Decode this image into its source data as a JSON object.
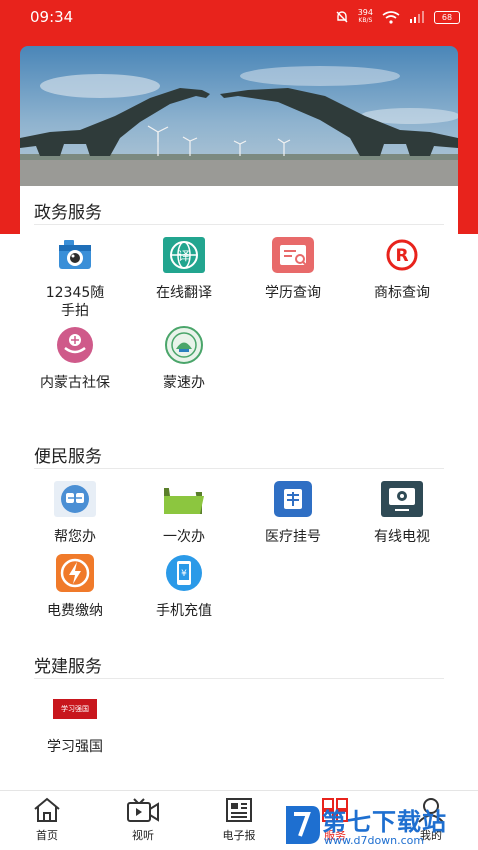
{
  "status_bar": {
    "time": "09:34",
    "speed": "394",
    "speed_unit": "KB/S",
    "battery": "68"
  },
  "sections": {
    "gov": {
      "title": "政务服务",
      "items": [
        {
          "label": "12345随手拍",
          "icon": "camera-icon"
        },
        {
          "label": "在线翻译",
          "icon": "translate-icon"
        },
        {
          "label": "学历查询",
          "icon": "degree-query-icon"
        },
        {
          "label": "商标查询",
          "icon": "trademark-icon"
        },
        {
          "label": "内蒙古社保",
          "icon": "social-security-icon"
        },
        {
          "label": "蒙速办",
          "icon": "mengsuban-icon"
        }
      ]
    },
    "people": {
      "title": "便民服务",
      "items": [
        {
          "label": "帮您办",
          "icon": "help-handle-icon"
        },
        {
          "label": "一次办",
          "icon": "folder-icon"
        },
        {
          "label": "医疗挂号",
          "icon": "medical-register-icon"
        },
        {
          "label": "有线电视",
          "icon": "tv-icon"
        },
        {
          "label": "电费缴纳",
          "icon": "electricity-icon"
        },
        {
          "label": "手机充值",
          "icon": "phone-recharge-icon"
        }
      ]
    },
    "party": {
      "title": "党建服务",
      "items": [
        {
          "label": "学习强国",
          "icon": "xuexi-icon",
          "badge_text": "学习强国"
        }
      ]
    }
  },
  "bottom_nav": [
    {
      "label": "首页",
      "icon": "home-icon"
    },
    {
      "label": "视听",
      "icon": "video-icon"
    },
    {
      "label": "电子报",
      "icon": "newspaper-icon"
    },
    {
      "label": "服务",
      "icon": "service-icon",
      "active": true
    },
    {
      "label": "我的",
      "icon": "profile-icon"
    }
  ],
  "watermark": {
    "title": "第七下载站",
    "url": "www.d7down.com"
  },
  "colors": {
    "brand_red": "#e8231c",
    "watermark_blue": "#1e6fd0"
  }
}
